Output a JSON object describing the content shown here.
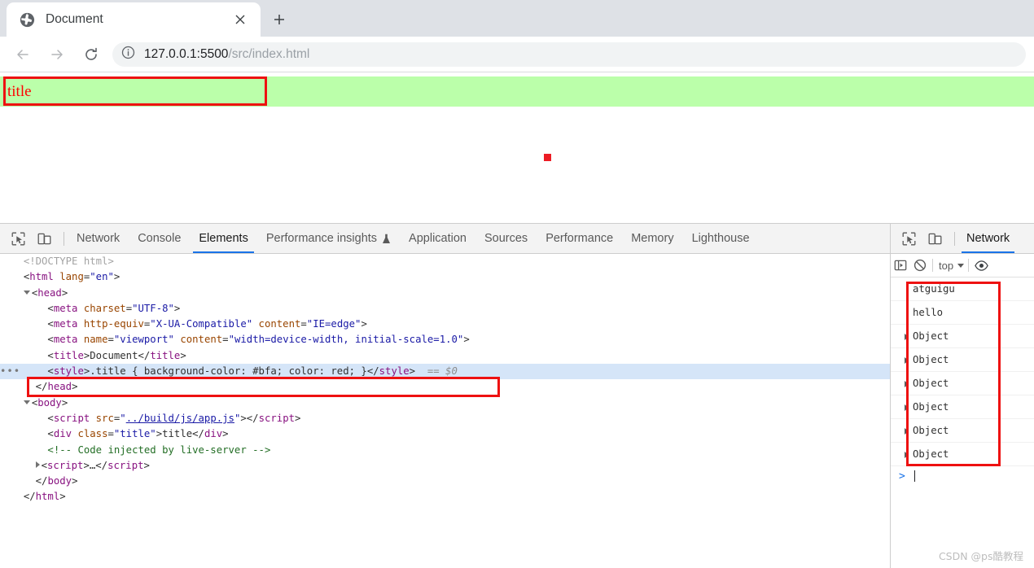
{
  "browser": {
    "tab": {
      "favicon": "globe-icon",
      "title": "Document",
      "close": "×"
    },
    "new_tab_label": "+",
    "nav": {
      "back": "back-arrow-icon",
      "forward": "forward-arrow-icon",
      "reload": "reload-icon"
    },
    "omnibox": {
      "info_icon": "info-circle-icon",
      "host": "127.0.0.1:5500",
      "path": "/src/index.html"
    }
  },
  "page": {
    "title_text": "title",
    "title_bg_color": "#bbffaa",
    "title_text_color": "#ff0000",
    "dot_color": "#ec1c24"
  },
  "devtools": {
    "left_toolbar": {
      "inspect_icon": "inspect-element-icon",
      "device_icon": "device-toolbar-icon"
    },
    "tabs": [
      {
        "label": "Network",
        "active": false
      },
      {
        "label": "Console",
        "active": false
      },
      {
        "label": "Elements",
        "active": true
      },
      {
        "label": "Performance insights",
        "active": false,
        "badge": "flask-icon"
      },
      {
        "label": "Application",
        "active": false
      },
      {
        "label": "Sources",
        "active": false
      },
      {
        "label": "Performance",
        "active": false
      },
      {
        "label": "Memory",
        "active": false
      },
      {
        "label": "Lighthouse",
        "active": false
      }
    ],
    "elements_tree": [
      {
        "id": "doctype",
        "indent": 0,
        "marker": "none",
        "selected": false,
        "parts": [
          {
            "c": "dcl",
            "t": "<!DOCTYPE html>"
          }
        ]
      },
      {
        "id": "html-open",
        "indent": 0,
        "marker": "none",
        "selected": false,
        "parts": [
          {
            "c": "pt",
            "t": "<"
          },
          {
            "c": "tw",
            "t": "html"
          },
          {
            "c": "at",
            "t": " lang"
          },
          {
            "c": "pt",
            "t": "="
          },
          {
            "c": "av",
            "t": "\"en\""
          },
          {
            "c": "pt",
            "t": ">"
          }
        ]
      },
      {
        "id": "head-open",
        "indent": 0,
        "marker": "open",
        "selected": false,
        "parts": [
          {
            "c": "pt",
            "t": "<"
          },
          {
            "c": "tw",
            "t": "head"
          },
          {
            "c": "pt",
            "t": ">"
          }
        ]
      },
      {
        "id": "meta-charset",
        "indent": 2,
        "marker": "none",
        "selected": false,
        "parts": [
          {
            "c": "pt",
            "t": "<"
          },
          {
            "c": "tw",
            "t": "meta"
          },
          {
            "c": "at",
            "t": " charset"
          },
          {
            "c": "pt",
            "t": "="
          },
          {
            "c": "av",
            "t": "\"UTF-8\""
          },
          {
            "c": "pt",
            "t": ">"
          }
        ]
      },
      {
        "id": "meta-compat",
        "indent": 2,
        "marker": "none",
        "selected": false,
        "parts": [
          {
            "c": "pt",
            "t": "<"
          },
          {
            "c": "tw",
            "t": "meta"
          },
          {
            "c": "at",
            "t": " http-equiv"
          },
          {
            "c": "pt",
            "t": "="
          },
          {
            "c": "av",
            "t": "\"X-UA-Compatible\""
          },
          {
            "c": "at",
            "t": " content"
          },
          {
            "c": "pt",
            "t": "="
          },
          {
            "c": "av",
            "t": "\"IE=edge\""
          },
          {
            "c": "pt",
            "t": ">"
          }
        ]
      },
      {
        "id": "meta-viewport",
        "indent": 2,
        "marker": "none",
        "selected": false,
        "parts": [
          {
            "c": "pt",
            "t": "<"
          },
          {
            "c": "tw",
            "t": "meta"
          },
          {
            "c": "at",
            "t": " name"
          },
          {
            "c": "pt",
            "t": "="
          },
          {
            "c": "av",
            "t": "\"viewport\""
          },
          {
            "c": "at",
            "t": " content"
          },
          {
            "c": "pt",
            "t": "="
          },
          {
            "c": "av",
            "t": "\"width=device-width, initial-scale=1.0\""
          },
          {
            "c": "pt",
            "t": ">"
          }
        ]
      },
      {
        "id": "title-el",
        "indent": 2,
        "marker": "none",
        "selected": false,
        "parts": [
          {
            "c": "pt",
            "t": "<"
          },
          {
            "c": "tw",
            "t": "title"
          },
          {
            "c": "pt",
            "t": ">"
          },
          {
            "c": "txt",
            "t": "Document"
          },
          {
            "c": "pt",
            "t": "</"
          },
          {
            "c": "tw",
            "t": "title"
          },
          {
            "c": "pt",
            "t": ">"
          }
        ]
      },
      {
        "id": "style-el",
        "indent": 2,
        "marker": "dots",
        "selected": true,
        "parts": [
          {
            "c": "pt",
            "t": "<"
          },
          {
            "c": "tw",
            "t": "style"
          },
          {
            "c": "pt",
            "t": ">"
          },
          {
            "c": "txt",
            "t": ".title { background-color: #bfa; color: red; }"
          },
          {
            "c": "pt",
            "t": "</"
          },
          {
            "c": "tw",
            "t": "style"
          },
          {
            "c": "pt",
            "t": ">"
          },
          {
            "c": "dollar",
            "t": "  == $0"
          }
        ]
      },
      {
        "id": "head-close",
        "indent": 1,
        "marker": "none",
        "selected": false,
        "parts": [
          {
            "c": "pt",
            "t": "</"
          },
          {
            "c": "tw",
            "t": "head"
          },
          {
            "c": "pt",
            "t": ">"
          }
        ]
      },
      {
        "id": "body-open",
        "indent": 0,
        "marker": "open",
        "selected": false,
        "parts": [
          {
            "c": "pt",
            "t": "<"
          },
          {
            "c": "tw",
            "t": "body"
          },
          {
            "c": "pt",
            "t": ">"
          }
        ]
      },
      {
        "id": "script-src",
        "indent": 2,
        "marker": "none",
        "selected": false,
        "parts": [
          {
            "c": "pt",
            "t": "<"
          },
          {
            "c": "tw",
            "t": "script"
          },
          {
            "c": "at",
            "t": " src"
          },
          {
            "c": "pt",
            "t": "="
          },
          {
            "c": "av",
            "t": "\""
          },
          {
            "c": "lnk",
            "t": "../build/js/app.js"
          },
          {
            "c": "av",
            "t": "\""
          },
          {
            "c": "pt",
            "t": ">"
          },
          {
            "c": "pt",
            "t": "</"
          },
          {
            "c": "tw",
            "t": "script"
          },
          {
            "c": "pt",
            "t": ">"
          }
        ]
      },
      {
        "id": "div-title",
        "indent": 2,
        "marker": "none",
        "selected": false,
        "parts": [
          {
            "c": "pt",
            "t": "<"
          },
          {
            "c": "tw",
            "t": "div"
          },
          {
            "c": "at",
            "t": " class"
          },
          {
            "c": "pt",
            "t": "="
          },
          {
            "c": "av",
            "t": "\"title\""
          },
          {
            "c": "pt",
            "t": ">"
          },
          {
            "c": "txt",
            "t": "title"
          },
          {
            "c": "pt",
            "t": "</"
          },
          {
            "c": "tw",
            "t": "div"
          },
          {
            "c": "pt",
            "t": ">"
          }
        ]
      },
      {
        "id": "comment-live",
        "indent": 2,
        "marker": "none",
        "selected": false,
        "parts": [
          {
            "c": "cmt",
            "t": "<!-- Code injected by live-server -->"
          }
        ]
      },
      {
        "id": "script-collapsed",
        "indent": 1,
        "marker": "closed",
        "selected": false,
        "parts": [
          {
            "c": "pt",
            "t": "<"
          },
          {
            "c": "tw",
            "t": "script"
          },
          {
            "c": "pt",
            "t": ">"
          },
          {
            "c": "txt",
            "t": "…"
          },
          {
            "c": "pt",
            "t": "</"
          },
          {
            "c": "tw",
            "t": "script"
          },
          {
            "c": "pt",
            "t": ">"
          }
        ]
      },
      {
        "id": "body-close",
        "indent": 1,
        "marker": "none",
        "selected": false,
        "parts": [
          {
            "c": "pt",
            "t": "</"
          },
          {
            "c": "tw",
            "t": "body"
          },
          {
            "c": "pt",
            "t": ">"
          }
        ]
      },
      {
        "id": "html-close",
        "indent": 0,
        "marker": "none",
        "selected": false,
        "parts": [
          {
            "c": "pt",
            "t": "</"
          },
          {
            "c": "tw",
            "t": "html"
          },
          {
            "c": "pt",
            "t": ">"
          }
        ]
      }
    ],
    "right_panel": {
      "tab_label": "Network",
      "toolbar": {
        "sidebar_icon": "console-sidebar-icon",
        "clear_icon": "clear-console-icon",
        "context": "top",
        "eye_icon": "live-expression-eye-icon"
      },
      "log_entries": [
        {
          "text": "atguigu",
          "expandable": false
        },
        {
          "text": "hello",
          "expandable": false
        },
        {
          "text": "Object",
          "expandable": true
        },
        {
          "text": "Object",
          "expandable": true
        },
        {
          "text": "Object",
          "expandable": true
        },
        {
          "text": "Object",
          "expandable": true
        },
        {
          "text": "Object",
          "expandable": true
        },
        {
          "text": "Object",
          "expandable": true
        }
      ],
      "prompt_caret": ">"
    }
  },
  "watermark": "CSDN @ps酷教程"
}
